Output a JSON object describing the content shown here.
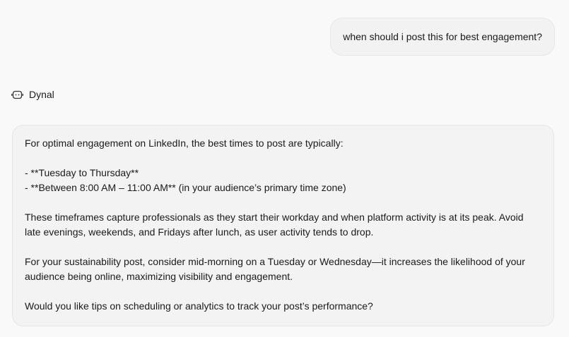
{
  "user_message": "when should i post this for best engagement?",
  "assistant": {
    "name": "Dynal",
    "icon": "bot-icon",
    "paragraphs": {
      "intro": "For optimal engagement on LinkedIn, the best times to post are typically:",
      "bullet_1": "- **Tuesday to Thursday**",
      "bullet_2": "- **Between 8:00 AM – 11:00 AM** (in your audience’s primary time zone)",
      "para_2": "These timeframes capture professionals as they start their workday and when platform activity is at its peak. Avoid late evenings, weekends, and Fridays after lunch, as user activity tends to drop.",
      "para_3": "For your sustainability post, consider mid-morning on a Tuesday or Wednesday—it increases the likelihood of your audience being online, maximizing visibility and engagement.",
      "para_4": "Would you like tips on scheduling or analytics to track your post’s performance?"
    }
  }
}
